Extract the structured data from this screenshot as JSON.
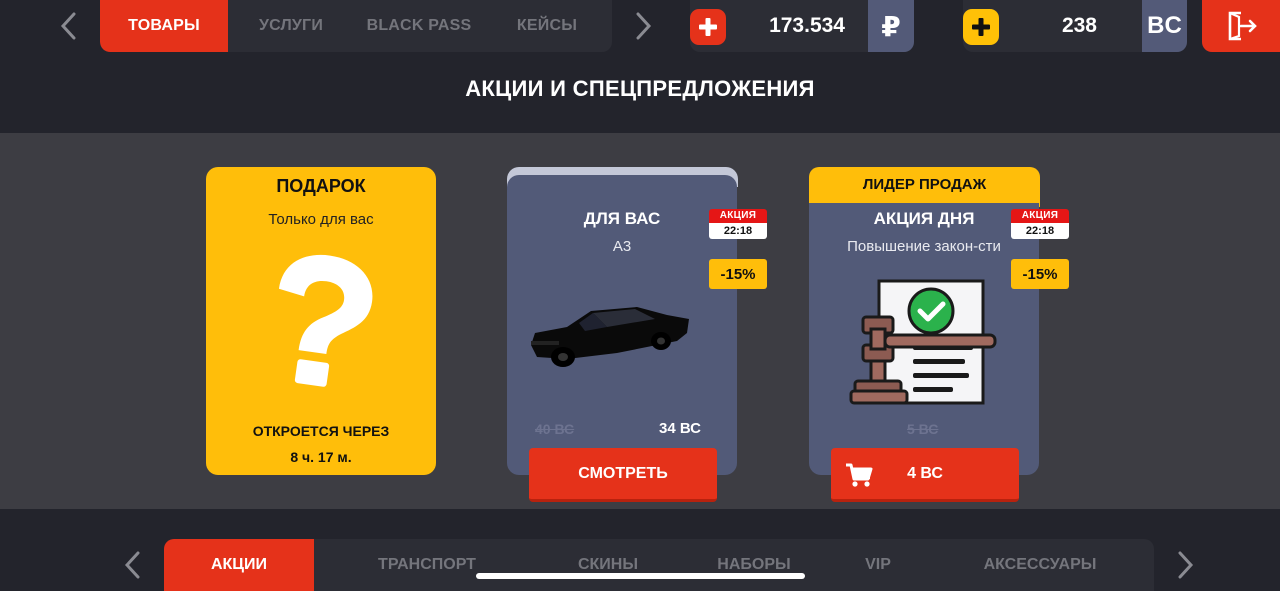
{
  "top_nav": {
    "tabs": [
      "ТОВАРЫ",
      "УСЛУГИ",
      "BLACK PASS",
      "КЕЙСЫ"
    ],
    "active_index": 0
  },
  "balances": {
    "rub": {
      "amount": "173.534",
      "currency": "₽",
      "plus_color": "#e5321a"
    },
    "bc": {
      "amount": "238",
      "currency": "BC",
      "plus_color": "#ffc107"
    }
  },
  "section_title": "АКЦИИ И СПЕЦПРЕДЛОЖЕНИЯ",
  "gift_card": {
    "title": "ПОДАРОК",
    "subtitle": "Только для вас",
    "opens_label": "ОТКРОЕТСЯ ЧЕРЕЗ",
    "time_left": "8 ч. 17 м."
  },
  "offer_for_you": {
    "title": "ДЛЯ ВАС",
    "subtitle": "А3",
    "badge_label": "АКЦИЯ",
    "badge_time": "22:18",
    "discount": "-15%",
    "old_price": "40 ВС",
    "new_price": "34 ВС",
    "button_label": "СМОТРЕТЬ",
    "image": "black-sedan-car"
  },
  "offer_of_day": {
    "ribbon": "ЛИДЕР ПРОДАЖ",
    "title": "АКЦИЯ ДНЯ",
    "subtitle": "Повышение закон-сти",
    "badge_label": "АКЦИЯ",
    "badge_time": "22:18",
    "discount": "-15%",
    "old_price": "5 ВС",
    "button_label": "4 ВС",
    "button_icon": "cart-icon",
    "image": "gavel-document-icon"
  },
  "categories": {
    "tabs": [
      "АКЦИИ",
      "ТРАНСПОРТ",
      "СКИНЫ",
      "НАБОРЫ",
      "VIP",
      "АКСЕССУАРЫ"
    ],
    "active_index": 0
  },
  "colors": {
    "accent_red": "#e5321a",
    "accent_yellow": "#ffbe0a",
    "card_blue": "#525a78",
    "background": "#23242c"
  }
}
